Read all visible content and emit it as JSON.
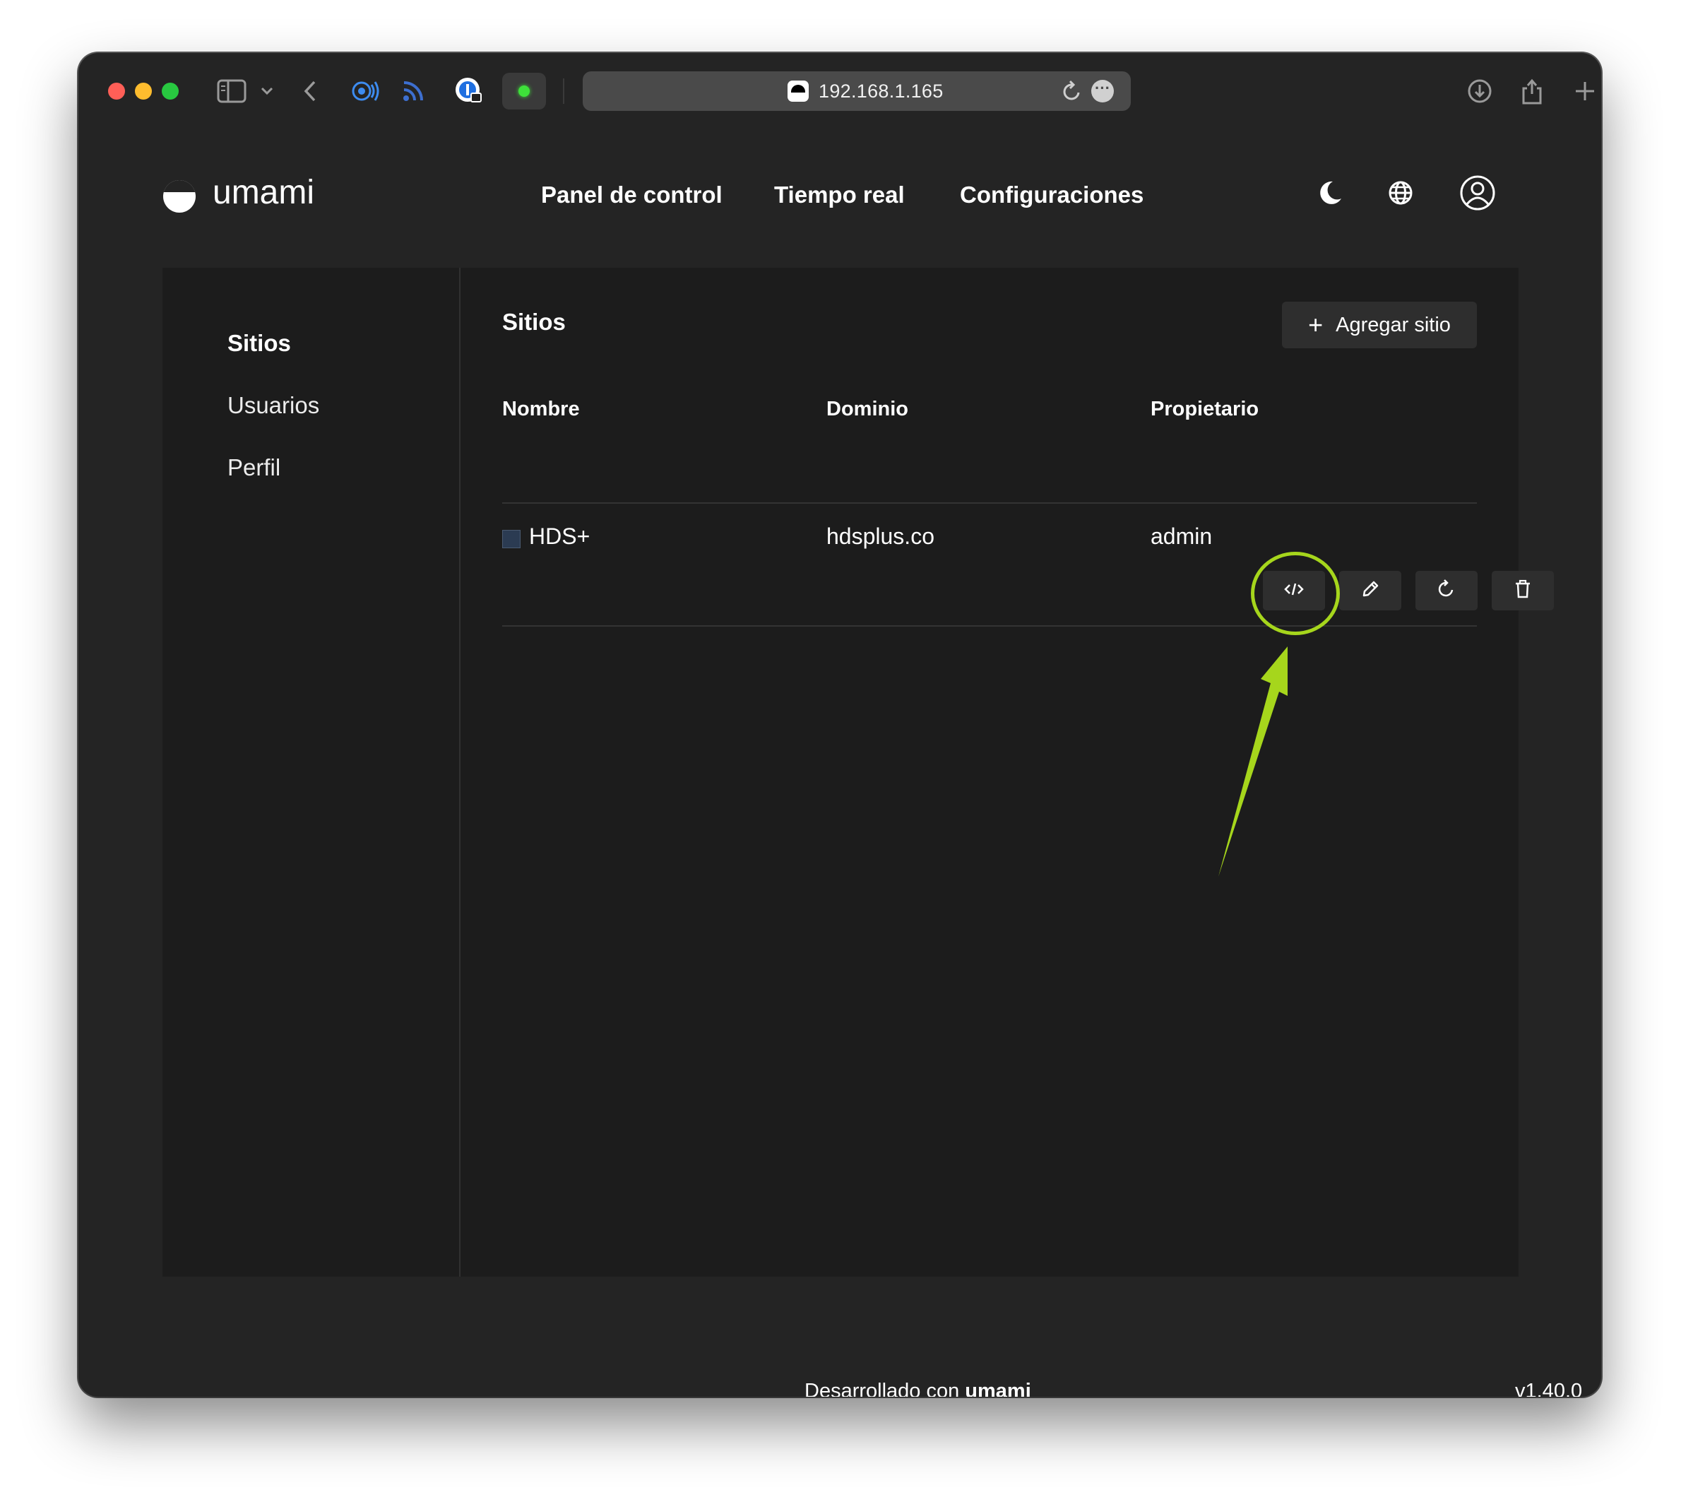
{
  "browser": {
    "url": "192.168.1.165"
  },
  "app": {
    "logo_text": "umami",
    "nav": [
      "Panel de control",
      "Tiempo real",
      "Configuraciones"
    ]
  },
  "sidebar": {
    "items": [
      {
        "label": "Sitios",
        "active": true
      },
      {
        "label": "Usuarios",
        "active": false
      },
      {
        "label": "Perfil",
        "active": false
      }
    ]
  },
  "main": {
    "title": "Sitios",
    "add_button": "Agregar sitio",
    "columns": [
      "Nombre",
      "Dominio",
      "Propietario"
    ],
    "rows": [
      {
        "name": "HDS+",
        "domain": "hdsplus.co",
        "owner": "admin"
      }
    ]
  },
  "footer": {
    "prefix": "Desarrollado con",
    "brand": "umami",
    "version": "v1.40.0"
  },
  "colors": {
    "annotation": "#a6d61c",
    "background": "#242424",
    "panel": "#1c1c1c"
  }
}
